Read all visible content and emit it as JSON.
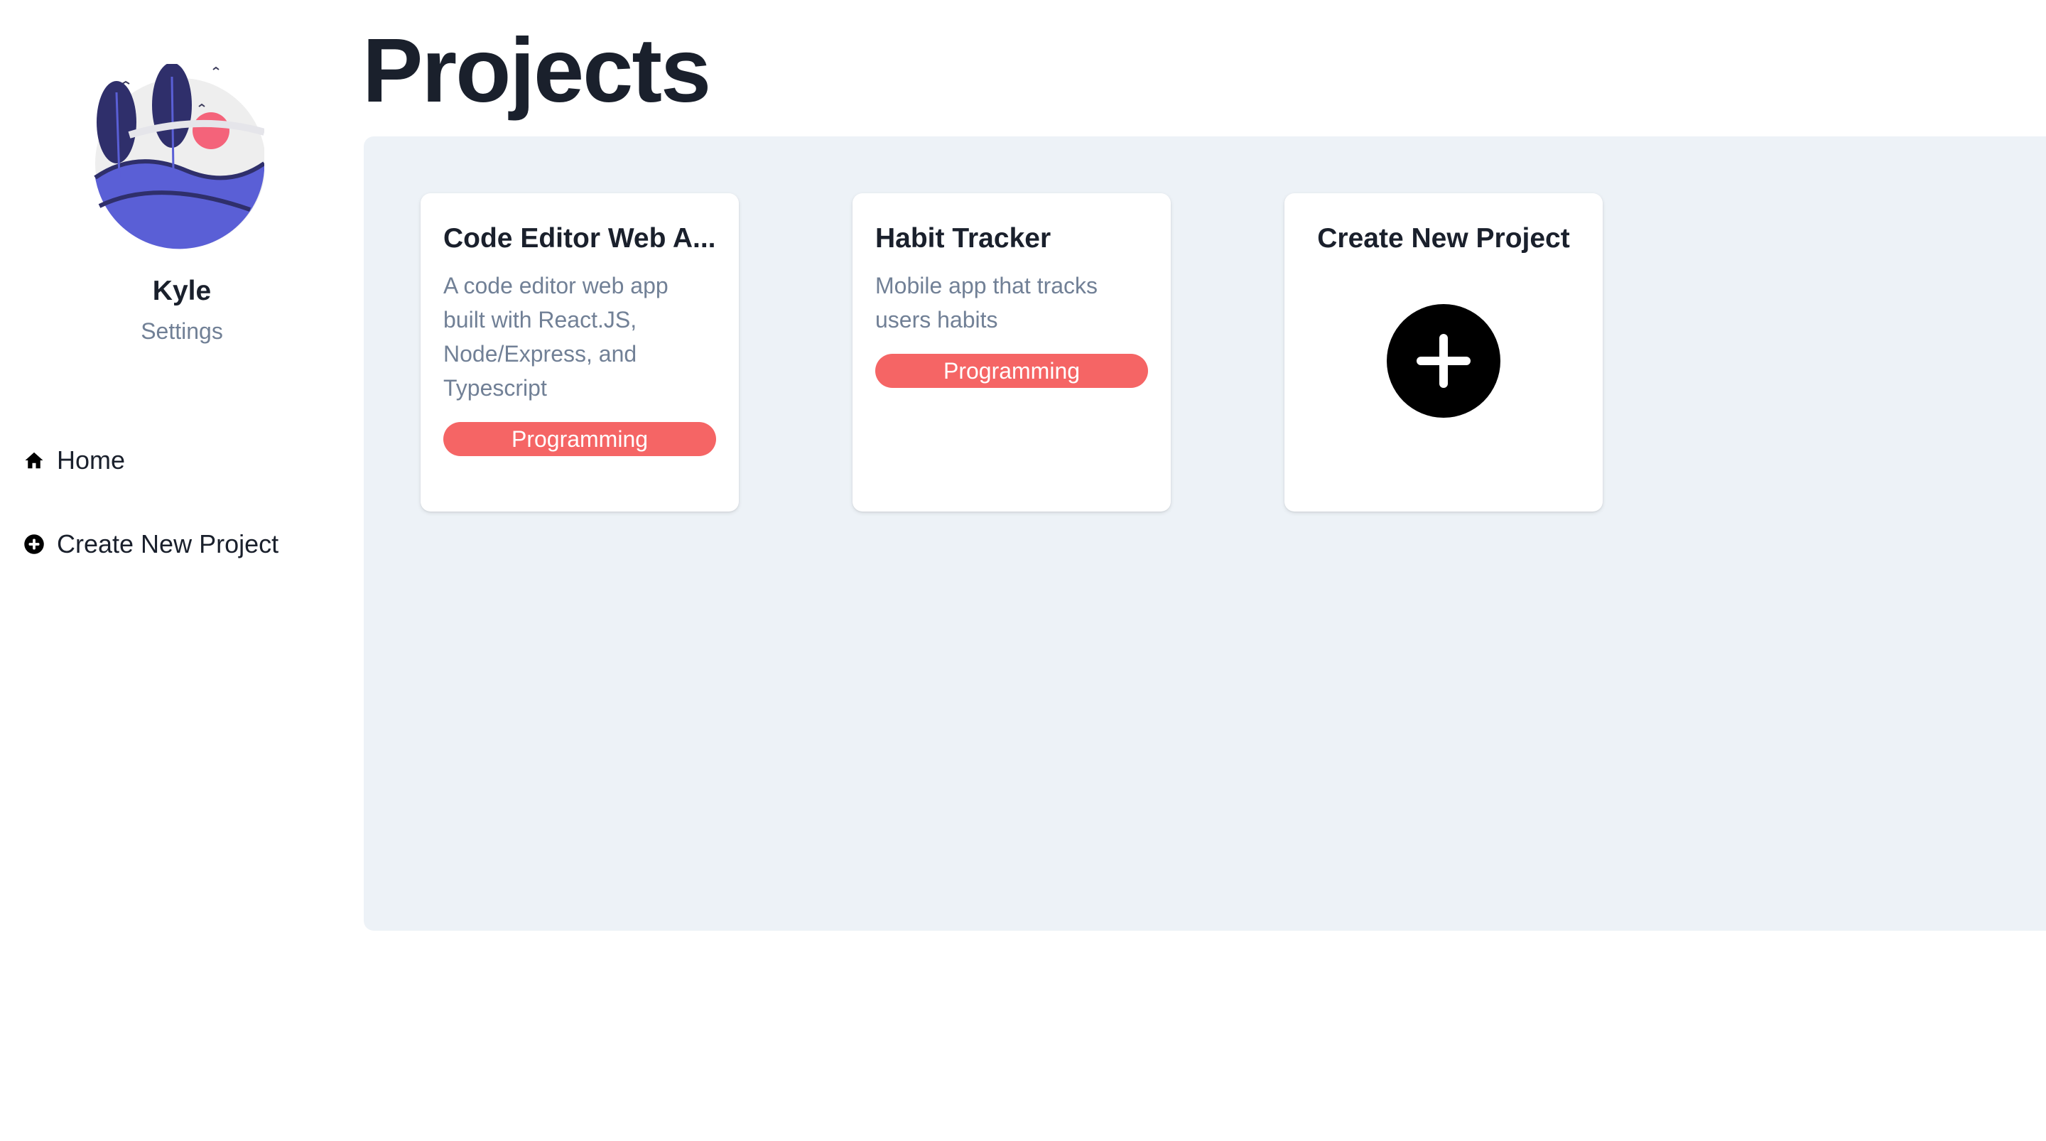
{
  "user": {
    "name": "Kyle",
    "settings_label": "Settings"
  },
  "nav": {
    "items": [
      {
        "label": "Home",
        "icon": "home-icon"
      },
      {
        "label": "Create New Project",
        "icon": "plus-circle-icon"
      }
    ]
  },
  "main": {
    "title": "Projects",
    "projects": [
      {
        "title": "Code Editor Web A...",
        "description": "A code editor web app built with React.JS, Node/Express, and Typescript",
        "tag": "Programming"
      },
      {
        "title": "Habit Tracker",
        "description": "Mobile app that tracks users habits",
        "tag": "Programming"
      }
    ],
    "create_card": {
      "title": "Create New Project",
      "icon": "plus-circle-icon"
    }
  },
  "colors": {
    "tag_bg": "#f56565",
    "board_bg": "#edf2f7",
    "muted_text": "#718096",
    "avatar_accent": "#5a5fd6",
    "avatar_sun": "#f4637a"
  }
}
